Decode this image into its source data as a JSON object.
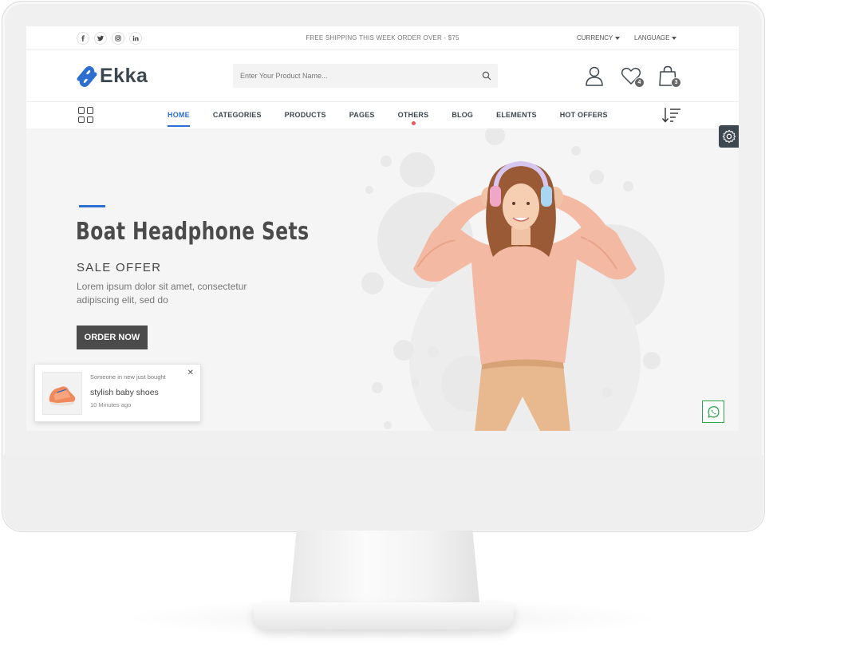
{
  "topbar": {
    "social": [
      "facebook-icon",
      "twitter-icon",
      "instagram-icon",
      "linkedin-icon"
    ],
    "promo": "FREE SHIPPING THIS WEEK ORDER OVER - $75",
    "currency_label": "CURRENCY",
    "language_label": "LANGUAGE"
  },
  "header": {
    "logo_text": "Ekka",
    "search_placeholder": "Enter Your Product Name...",
    "wishlist_count": "4",
    "cart_count": "3"
  },
  "nav": {
    "items": [
      "HOME",
      "CATEGORIES",
      "PRODUCTS",
      "PAGES",
      "OTHERS",
      "BLOG",
      "ELEMENTS",
      "HOT OFFERS"
    ],
    "active": "HOME"
  },
  "hero": {
    "title": "Boat Headphone Sets",
    "subtitle": "SALE OFFER",
    "description": "Lorem ipsum dolor sit amet, consectetur adipiscing elit, sed do",
    "cta_label": "ORDER NOW"
  },
  "toast": {
    "line1": "Someone in new just bought",
    "product": "stylish baby shoes",
    "time": "10 Minutes ago"
  },
  "colors": {
    "accent": "#2c6fd1",
    "dark": "#3d4750",
    "hero_bg": "#f5f5f5",
    "whatsapp": "#2aa34a"
  }
}
